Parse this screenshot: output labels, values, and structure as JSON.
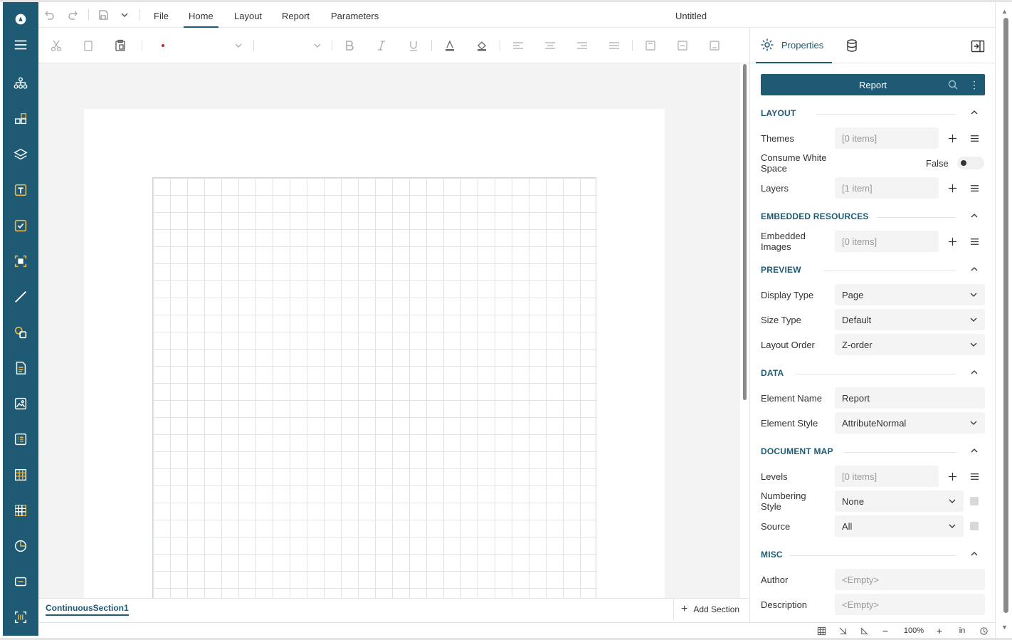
{
  "menubar": {
    "items": [
      "File",
      "Home",
      "Layout",
      "Report",
      "Parameters"
    ],
    "active": "Home",
    "document_title": "Untitled"
  },
  "toolbar": {
    "font_color_marker": "#cc2222"
  },
  "canvas": {
    "section_name": "ContinuousSection1",
    "add_section_label": "Add Section"
  },
  "statusbar": {
    "zoom": "100%",
    "unit": "in"
  },
  "panel": {
    "tab_properties": "Properties",
    "selected_object": "Report",
    "categories": [
      {
        "title": "LAYOUT"
      },
      {
        "title": "EMBEDDED RESOURCES"
      },
      {
        "title": "PREVIEW"
      },
      {
        "title": "DATA"
      },
      {
        "title": "DOCUMENT MAP"
      },
      {
        "title": "MISC"
      }
    ],
    "props": {
      "themes": {
        "label": "Themes",
        "value": "[0 items]"
      },
      "consume_white_space": {
        "label": "Consume White Space",
        "value": "False"
      },
      "layers": {
        "label": "Layers",
        "value": "[1 item]"
      },
      "embedded_images": {
        "label": "Embedded Images",
        "value": "[0 items]"
      },
      "display_type": {
        "label": "Display Type",
        "value": "Page"
      },
      "size_type": {
        "label": "Size Type",
        "value": "Default"
      },
      "layout_order": {
        "label": "Layout Order",
        "value": "Z-order"
      },
      "element_name": {
        "label": "Element Name",
        "value": "Report"
      },
      "element_style": {
        "label": "Element Style",
        "value": "AttributeNormal"
      },
      "levels": {
        "label": "Levels",
        "value": "[0 items]"
      },
      "numbering_style": {
        "label": "Numbering Style",
        "value": "None"
      },
      "source": {
        "label": "Source",
        "value": "All"
      },
      "author": {
        "label": "Author",
        "value": "<Empty>"
      },
      "description": {
        "label": "Description",
        "value": "<Empty>"
      }
    }
  },
  "colors": {
    "rail": "#1e5a74",
    "accent": "#1e5a74",
    "rail_icon_highlight": "#e8b64a"
  }
}
